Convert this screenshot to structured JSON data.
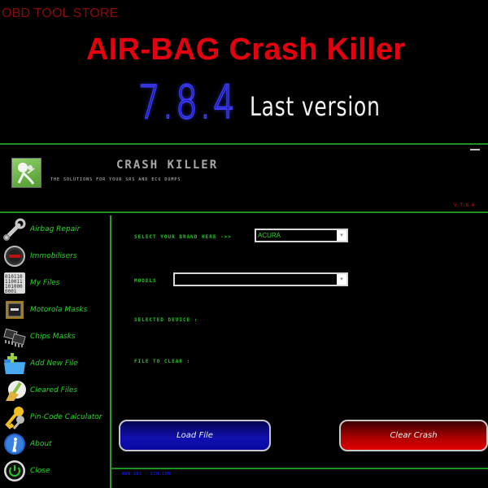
{
  "banner": {
    "store": "OBD TOOL STORE",
    "headline": "AIR-BAG Crash Killer",
    "version": "7.8.4",
    "version_note": "Last version"
  },
  "app": {
    "title": "CRASH KILLER",
    "subtitle": "THE SOLUTIONS FOR YOUR SRS AND ECU DUMPS",
    "version_tag": "V 7.8.4",
    "logo_icon": "airbag-icon",
    "minimize_icon": "minimize-icon"
  },
  "sidebar": {
    "items": [
      {
        "label": "Airbag Repair",
        "icon": "wrench-icon"
      },
      {
        "label": "Immobilisers",
        "icon": "immobiliser-icon"
      },
      {
        "label": "My Files",
        "icon": "binary-file-icon"
      },
      {
        "label": "Motorola Masks",
        "icon": "cpu-chip-icon"
      },
      {
        "label": "Chips Masks",
        "icon": "chips-icon"
      },
      {
        "label": "Add New File",
        "icon": "add-folder-icon"
      },
      {
        "label": "Cleared Files",
        "icon": "broom-icon"
      },
      {
        "label": "Pin-Code Calculator",
        "icon": "keys-icon"
      },
      {
        "label": "About",
        "icon": "info-icon"
      },
      {
        "label": "Close",
        "icon": "power-icon"
      }
    ]
  },
  "main": {
    "brand_label": "SELECT YOUR BRAND HERE ->>",
    "brand_value": "ACURA",
    "models_label": "MODELS",
    "models_value": "",
    "selected_device_label": "SELECTED DEVICE :",
    "file_to_clear_label": "FILE TO CLEAR :",
    "load_button": "Load File",
    "clear_button": "Clear Crash",
    "dropdown_arrow": "▾",
    "footer_text": "WWW.SRS - ECU.COM"
  },
  "colors": {
    "accent_green": "#28d828",
    "line_green": "#1f8f1f",
    "headline_red": "#e3000f",
    "button_blue": "#1010b0",
    "button_red": "#d00000"
  }
}
